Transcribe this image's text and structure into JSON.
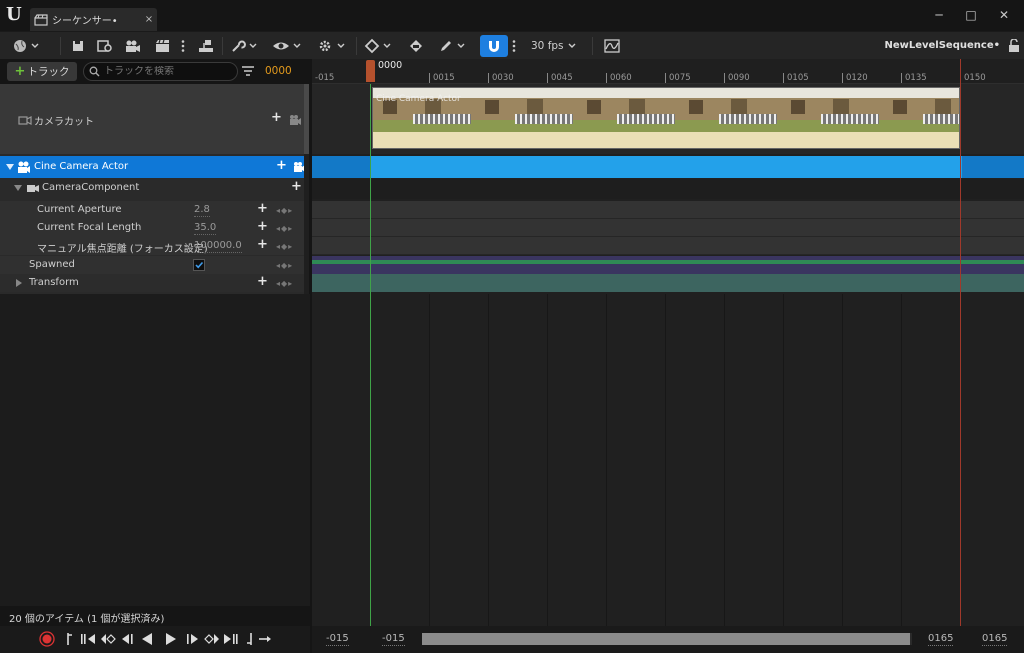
{
  "window": {
    "tab_title": "シーケンサー•",
    "tab_close": "×",
    "minimize": "─",
    "maximize": "□",
    "close": "✕"
  },
  "toolbar": {
    "fps": "30 fps",
    "sequence_name": "NewLevelSequence•",
    "snap_active_color": "#1e7fe0"
  },
  "track_panel": {
    "add_track_label": "トラック",
    "search_placeholder": "トラックを検索",
    "current_frame": "0000",
    "status": "20 個のアイテム (1 個が選択済み)",
    "rows": {
      "camera_cut": {
        "label": "カメラカット"
      },
      "cine_camera": {
        "label": "Cine Camera Actor"
      },
      "camera_component": {
        "label": "CameraComponent"
      },
      "aperture": {
        "label": "Current Aperture",
        "value": "2.8"
      },
      "focal_length": {
        "label": "Current Focal Length",
        "value": "35.0"
      },
      "manual_focus": {
        "label": "マニュアル焦点距離 (フォーカス設定)",
        "value": "100000.0"
      },
      "spawned": {
        "label": "Spawned",
        "checked": true
      },
      "transform": {
        "label": "Transform"
      }
    }
  },
  "timeline": {
    "playhead_label": "0000",
    "ticks": [
      "-015",
      "0015",
      "0030",
      "0045",
      "0060",
      "0075",
      "0090",
      "0105",
      "0120",
      "0135",
      "0150"
    ],
    "shot_name": "Cine Camera Actor",
    "range_start_outer": "-015",
    "range_start": "-015",
    "range_end": "0165",
    "range_end_outer": "0165",
    "selection_color": "#0f78d7"
  }
}
